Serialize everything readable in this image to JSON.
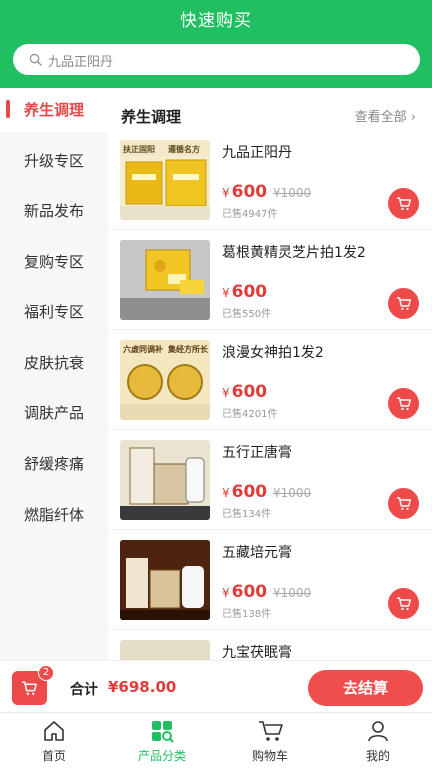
{
  "header": {
    "title": "快速购买"
  },
  "search": {
    "placeholder": "九品正阳丹"
  },
  "sidebar": {
    "items": [
      {
        "label": "养生调理",
        "active": true
      },
      {
        "label": "升级专区"
      },
      {
        "label": "新品发布"
      },
      {
        "label": "复购专区"
      },
      {
        "label": "福利专区"
      },
      {
        "label": "皮肤抗衰"
      },
      {
        "label": "调肤产品"
      },
      {
        "label": "舒缓疼痛"
      },
      {
        "label": "燃脂纤体"
      }
    ]
  },
  "section": {
    "title": "养生调理",
    "view_all": "查看全部"
  },
  "products": [
    {
      "name": "九品正阳丹",
      "currency": "¥",
      "price": "600",
      "original_price": "¥1000",
      "sold": "已售4947件",
      "image_text_1": "扶正固阳",
      "image_text_2": "遵循名方"
    },
    {
      "name": "葛根黄精灵芝片拍1发2",
      "currency": "¥",
      "price": "600",
      "original_price": "",
      "sold": "已售550件"
    },
    {
      "name": "浪漫女神拍1发2",
      "currency": "¥",
      "price": "600",
      "original_price": "",
      "sold": "已售4201件",
      "image_text_1": "六虚同调补",
      "image_text_2": "集经方所长"
    },
    {
      "name": "五行正唐膏",
      "currency": "¥",
      "price": "600",
      "original_price": "¥1000",
      "sold": "已售134件"
    },
    {
      "name": "五藏培元膏",
      "currency": "¥",
      "price": "600",
      "original_price": "¥1000",
      "sold": "已售138件"
    },
    {
      "name": "九宝茯眠膏"
    }
  ],
  "checkout": {
    "cart_count": "2",
    "total_label": "合计",
    "total_value": "¥698.00",
    "button": "去结算"
  },
  "tabbar": {
    "items": [
      {
        "label": "首页",
        "icon": "home-icon"
      },
      {
        "label": "产品分类",
        "icon": "category-icon",
        "active": true
      },
      {
        "label": "购物车",
        "icon": "cart-icon"
      },
      {
        "label": "我的",
        "icon": "user-icon"
      }
    ]
  },
  "colors": {
    "brand_green": "#1fbf62",
    "accent_red": "#e23b3b"
  }
}
